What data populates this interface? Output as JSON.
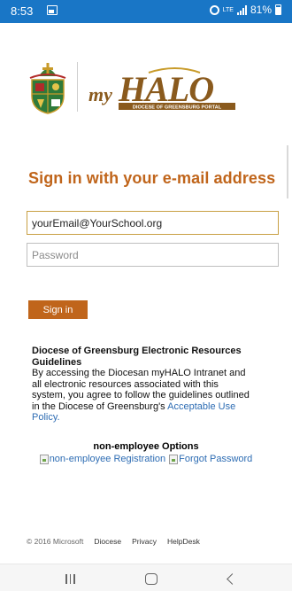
{
  "status_bar": {
    "time": "8:53",
    "network_label": "LTE",
    "battery": "81%",
    "bar_color": "#1976c6"
  },
  "logo": {
    "wordmark_text": "myHALO",
    "wordmark_subtitle": "DIOCESE OF GREENSBURG PORTAL",
    "brand_color": "#8a5a1d"
  },
  "signin": {
    "heading": "Sign in with your e-mail address",
    "email_value": "yourEmail@YourSchool.org",
    "password_placeholder": "Password",
    "button_label": "Sign in",
    "accent_color": "#c0651b"
  },
  "guidelines": {
    "title": "Diocese of Greensburg Electronic Resources Guidelines",
    "body": "By accessing the Diocesan myHALO Intranet and all electronic resources associated with this system, you agree to follow the guidelines outlined in the Diocese of Greensburg's ",
    "link_text": "Acceptable Use Policy."
  },
  "options": {
    "title": "non-employee Options",
    "registration_link": "non-employee Registration",
    "forgot_link": "Forgot Password"
  },
  "footer": {
    "copyright": "© 2016 Microsoft",
    "links": [
      "Diocese",
      "Privacy",
      "HelpDesk"
    ]
  },
  "nav": {
    "icons": [
      "recents-icon",
      "home-icon",
      "back-icon"
    ]
  }
}
